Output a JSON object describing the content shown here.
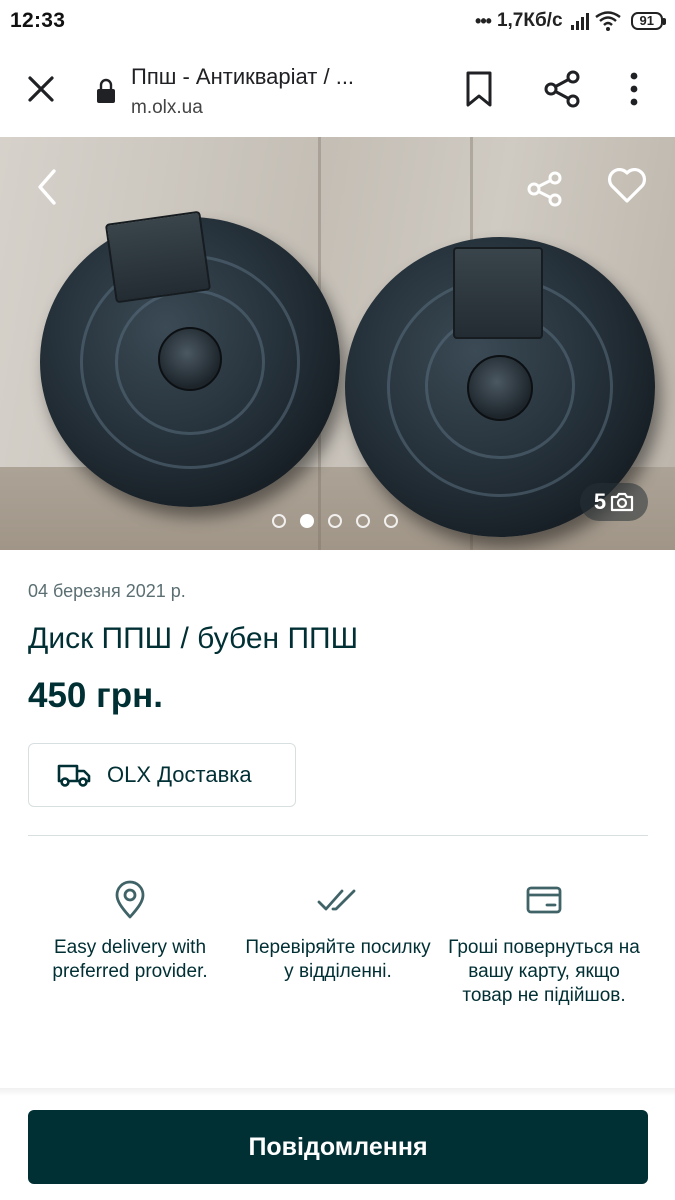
{
  "status_bar": {
    "time": "12:33",
    "network_speed": "1,7Кб/с",
    "battery": "91"
  },
  "browser": {
    "page_title": "Ппш - Антикваріат / ...",
    "url": "m.olx.ua"
  },
  "gallery": {
    "photo_count": "5",
    "current_index": 2,
    "total_dots": 5
  },
  "listing": {
    "date": "04 березня 2021 р.",
    "title": "Диск ППШ / бубен ППШ",
    "price": "450 грн.",
    "delivery_label": "OLX Доставка"
  },
  "features": [
    {
      "icon": "location-pin-icon",
      "text": "Easy delivery with preferred provider."
    },
    {
      "icon": "double-check-icon",
      "text": "Перевіряйте посилку у відділенні."
    },
    {
      "icon": "credit-card-icon",
      "text": "Гроші повернуться на вашу карту, якщо товар не підійшов."
    }
  ],
  "actions": {
    "message_button": "Повідомлення"
  },
  "colors": {
    "brand_dark": "#002f34",
    "icon_teal": "#406367",
    "muted_text": "#5b6f73"
  }
}
